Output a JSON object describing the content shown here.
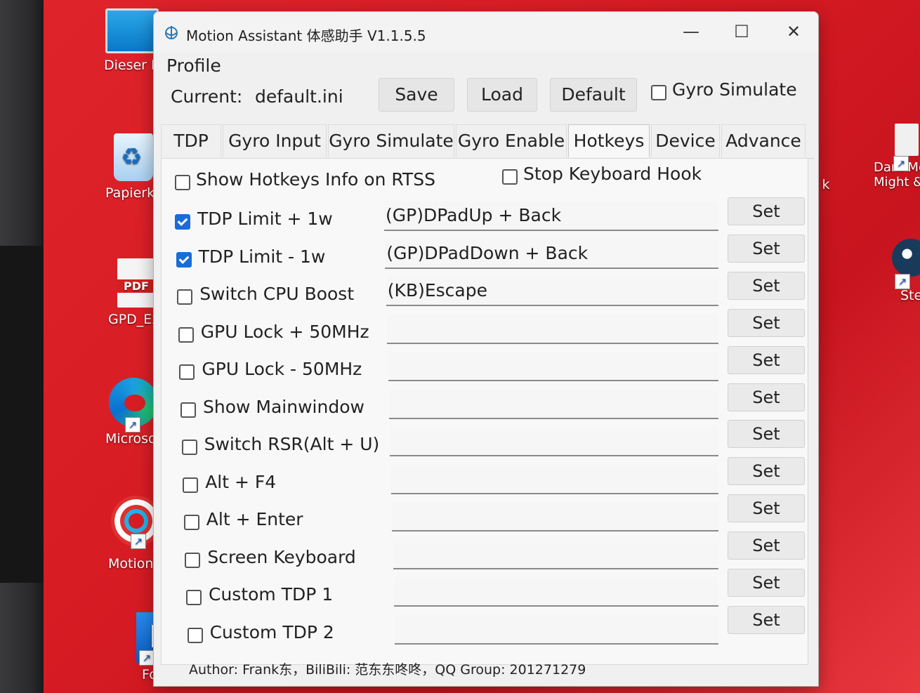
{
  "desktop": {
    "icons": [
      {
        "label": "Dieser P",
        "icon": "monitor-icon"
      },
      {
        "label": "Papierko",
        "icon": "recycle-bin-icon"
      },
      {
        "label": "GPD_Expl",
        "icon": "pdf-icon",
        "badge": "PDF"
      },
      {
        "label": "Microsoft E",
        "icon": "edge-icon"
      },
      {
        "label": "Motion Ass",
        "icon": "target-icon"
      },
      {
        "label": "Fortnite",
        "icon": "fortnite-icon",
        "badge": "F"
      },
      {
        "label": "Dark Me\nMight &",
        "icon": "file-icon"
      },
      {
        "label": "Ste",
        "icon": "steam-icon"
      },
      {
        "label": "k",
        "icon": "partial-label"
      }
    ]
  },
  "window": {
    "title": "Motion Assistant 体感助手 V1.1.5.5",
    "controls": {
      "minimize": "—",
      "maximize": "☐",
      "close": "✕"
    }
  },
  "profile": {
    "label": "Profile",
    "current_label": "Current:",
    "current_value": "default.ini",
    "save": "Save",
    "load": "Load",
    "default": "Default",
    "gyro_simulate": {
      "label": "Gyro Simulate",
      "checked": false
    }
  },
  "tabs": [
    "TDP",
    "Gyro Input",
    "Gyro Simulate",
    "Gyro Enable",
    "Hotkeys",
    "Device",
    "Advance"
  ],
  "active_tab": "Hotkeys",
  "hotkeys": {
    "show_rtss": {
      "label": "Show Hotkeys Info on RTSS",
      "checked": false
    },
    "stop_hook": {
      "label": "Stop Keyboard Hook",
      "checked": false
    },
    "set_label": "Set",
    "rows": [
      {
        "label": "TDP Limit + 1w",
        "checked": true,
        "value": "(GP)DPadUp + Back"
      },
      {
        "label": "TDP Limit - 1w",
        "checked": true,
        "value": "(GP)DPadDown + Back"
      },
      {
        "label": "Switch CPU Boost",
        "checked": false,
        "value": "(KB)Escape"
      },
      {
        "label": "GPU Lock + 50MHz",
        "checked": false,
        "value": ""
      },
      {
        "label": "GPU Lock - 50MHz",
        "checked": false,
        "value": ""
      },
      {
        "label": "Show Mainwindow",
        "checked": false,
        "value": ""
      },
      {
        "label": "Switch RSR(Alt + U)",
        "checked": false,
        "value": ""
      },
      {
        "label": "Alt + F4",
        "checked": false,
        "value": ""
      },
      {
        "label": "Alt + Enter",
        "checked": false,
        "value": ""
      },
      {
        "label": "Screen Keyboard",
        "checked": false,
        "value": ""
      },
      {
        "label": "Custom TDP 1",
        "checked": false,
        "value": ""
      },
      {
        "label": "Custom TDP 2",
        "checked": false,
        "value": ""
      }
    ]
  },
  "footer": "Author: Frank东，BiliBili: 范东东咚咚，QQ Group: 201271279",
  "colors": {
    "desktop_red": "#d81c24",
    "checkbox_checked": "#1a6cd8",
    "window_bg": "#f0f0f0"
  }
}
